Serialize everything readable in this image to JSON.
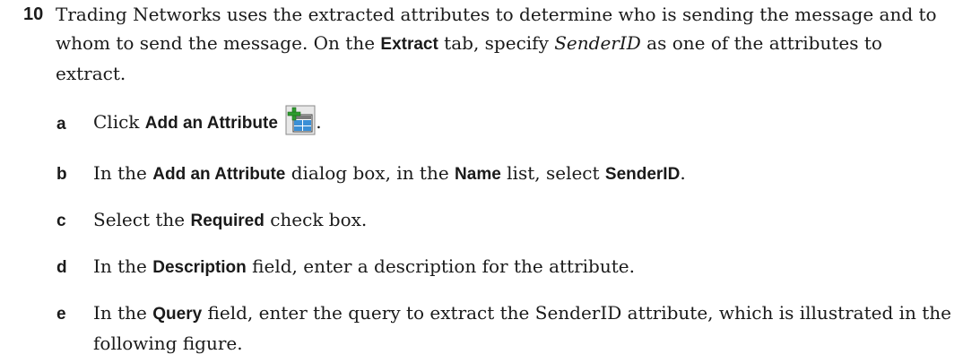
{
  "step": {
    "number": "10",
    "text1": "Trading Networks uses the extracted attributes to determine who is sending the message and to whom to send the message. On the ",
    "bold1": "Extract",
    "text2": " tab, specify ",
    "italic1": "SenderID",
    "text3": " as one of the attributes to extract."
  },
  "substeps": [
    {
      "letter": "a",
      "t1": "Click ",
      "b1": "Add an Attribute",
      "t2": " ",
      "icon": "add-attribute-icon",
      "t3": "."
    },
    {
      "letter": "b",
      "t1": "In the ",
      "b1": "Add an Attribute",
      "t2": " dialog box, in the ",
      "b2": "Name",
      "t3": " list, select ",
      "b3": "SenderID",
      "t4": "."
    },
    {
      "letter": "c",
      "t1": "Select the ",
      "b1": "Required",
      "t2": " check box."
    },
    {
      "letter": "d",
      "t1": "In the ",
      "b1": "Description",
      "t2": " field, enter a description for the attribute."
    },
    {
      "letter": "e",
      "t1": "In the ",
      "b1": "Query",
      "t2": " field, enter the query to extract the SenderID attribute, which is illustrated in the following figure."
    }
  ],
  "colors": {
    "icon_green": "#2e9b2e",
    "icon_blue": "#3a8fd6",
    "icon_frame": "#555555"
  }
}
